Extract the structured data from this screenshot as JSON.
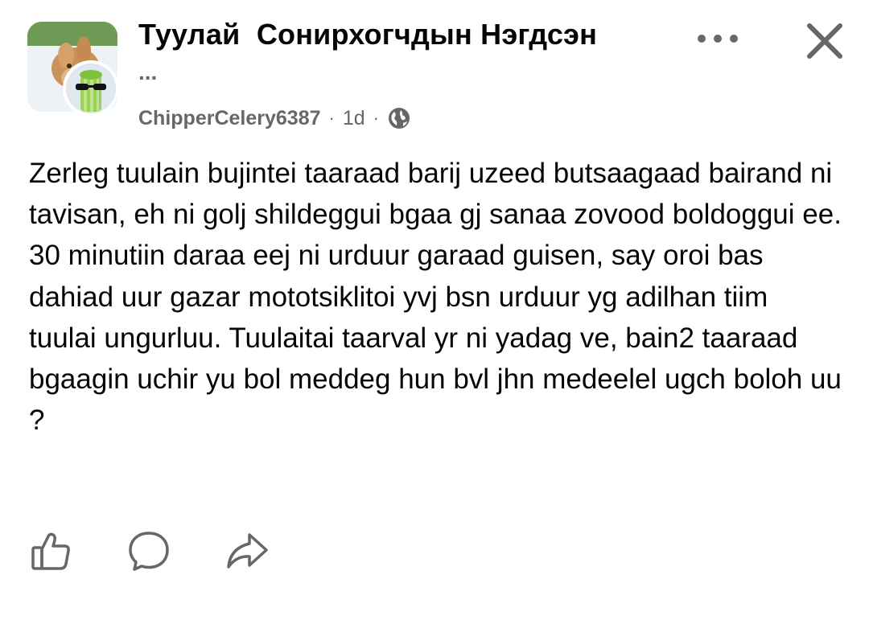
{
  "post": {
    "group_name": "Туулай  Сонирхогчдын Нэгдсэн",
    "group_name_overflow": "...",
    "author": "ChipperCelery6387",
    "separator": "·",
    "time": "1d",
    "privacy_icon": "globe-icon",
    "body": "Zerleg tuulain bujintei taaraad barij uzeed butsaagaad bairand ni tavisan, eh ni golj shildeggui bgaa gj sanaa zovood boldoggui ee. 30 minutiin daraa eej ni urduur garaad guisen, say oroi bas dahiad uur gazar mototsiklitoi yvj bsn urduur yg adilhan tiim tuulai ungurluu. Tuulaitai taarval yr ni yadag ve, bain2 taaraad bgaagin uchir yu bol meddeg hun bvl jhn medeelel ugch boloh uu ?"
  },
  "header": {
    "more_icon": "more-dots-icon",
    "close_icon": "close-icon"
  },
  "actions": [
    {
      "name": "like",
      "icon": "thumbs-up-icon"
    },
    {
      "name": "comment",
      "icon": "comment-icon"
    },
    {
      "name": "share",
      "icon": "share-icon"
    }
  ],
  "colors": {
    "text": "#050505",
    "secondary": "#65676b",
    "icon": "#65676b",
    "background": "#ffffff"
  }
}
